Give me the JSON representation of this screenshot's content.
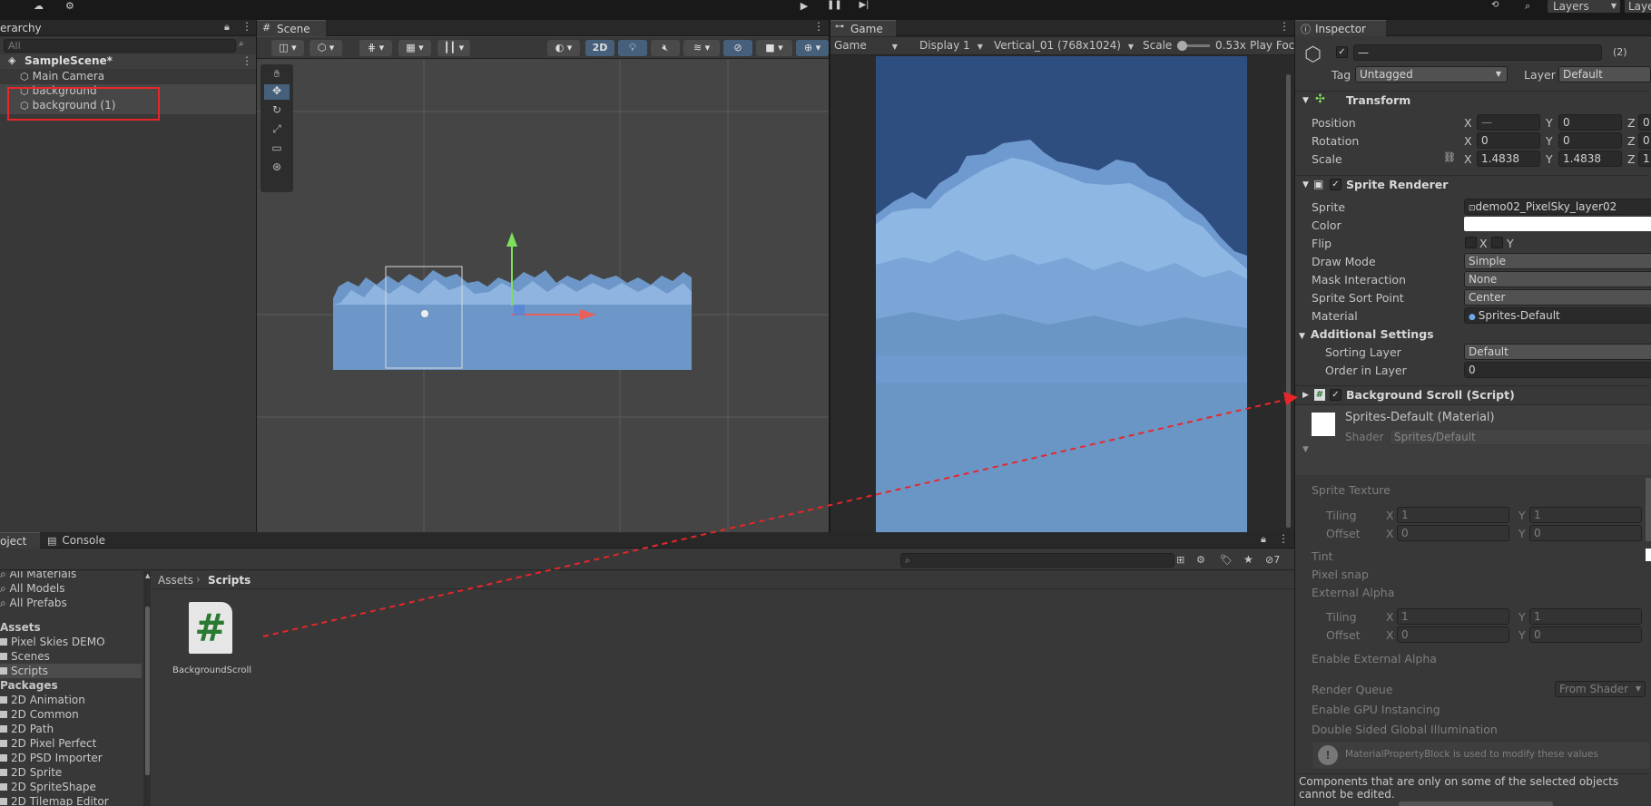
{
  "toolbar": {
    "layers": "Layers",
    "layers2": "Layer"
  },
  "hierarchy": {
    "tab": "erarchy",
    "search": "All",
    "scene": "SampleScene*",
    "items": [
      "Main Camera",
      "background",
      "background (1)"
    ]
  },
  "scene": {
    "tab": "Scene",
    "btn2d": "2D"
  },
  "game": {
    "tab": "Game",
    "display": "Game",
    "display_num": "Display 1",
    "resolution": "Vertical_01 (768x1024)",
    "scale_label": "Scale",
    "scale_value": "0.53x",
    "play": "Play Foc"
  },
  "project": {
    "tab_project": "oject",
    "tab_console": "Console",
    "favorites": [
      "All Materials",
      "All Models",
      "All Prefabs"
    ],
    "assets_header": "Assets",
    "assets": [
      "Pixel Skies DEMO",
      "Scenes",
      "Scripts"
    ],
    "packages_header": "Packages",
    "packages": [
      "2D Animation",
      "2D Common",
      "2D Path",
      "2D Pixel Perfect",
      "2D PSD Importer",
      "2D Sprite",
      "2D SpriteShape",
      "2D Tilemap Editor"
    ],
    "breadcrumb_root": "Assets",
    "breadcrumb_current": "Scripts",
    "file_name": "BackgroundScroll",
    "hidden_count": "7"
  },
  "inspector": {
    "tab": "Inspector",
    "object_name": "—",
    "multi_count": "(2)",
    "tag_label": "Tag",
    "tag_value": "Untagged",
    "layer_label": "Layer",
    "layer_value": "Default",
    "transform": {
      "title": "Transform",
      "position_label": "Position",
      "pos_x": "—",
      "pos_y": "0",
      "pos_z": "0",
      "rotation_label": "Rotation",
      "rot_x": "0",
      "rot_y": "0",
      "rot_z": "0",
      "scale_label": "Scale",
      "scale_x": "1.4838",
      "scale_y": "1.4838",
      "scale_z": "1."
    },
    "sprite_renderer": {
      "title": "Sprite Renderer",
      "sprite_label": "Sprite",
      "sprite_value": "demo02_PixelSky_layer02",
      "color_label": "Color",
      "flip_label": "Flip",
      "flip_x": "X",
      "flip_y": "Y",
      "draw_mode_label": "Draw Mode",
      "draw_mode_value": "Simple",
      "mask_label": "Mask Interaction",
      "mask_value": "None",
      "sort_point_label": "Sprite Sort Point",
      "sort_point_value": "Center",
      "material_label": "Material",
      "material_value": "Sprites-Default",
      "additional": "Additional Settings",
      "sorting_layer_label": "Sorting Layer",
      "sorting_layer_value": "Default",
      "order_label": "Order in Layer",
      "order_value": "0"
    },
    "script": {
      "title": "Background Scroll (Script)"
    },
    "material": {
      "title": "Sprites-Default (Material)",
      "shader_label": "Shader",
      "shader_value": "Sprites/Default",
      "sprite_texture": "Sprite Texture",
      "tiling": "Tiling",
      "offset": "Offset",
      "x": "X",
      "y": "Y",
      "tiling_x": "1",
      "tiling_y": "1",
      "offset_x": "0",
      "offset_y": "0",
      "tint": "Tint",
      "pixel_snap": "Pixel snap",
      "external_alpha": "External Alpha",
      "enable_external_alpha": "Enable External Alpha",
      "render_queue": "Render Queue",
      "render_queue_value": "From Shader",
      "gpu_instancing": "Enable GPU Instancing",
      "double_sided": "Double Sided Global Illumination",
      "info": "MaterialPropertyBlock is used to modify these values"
    },
    "footer": "Components that are only on some of the selected objects cannot be edited."
  },
  "colors": {
    "annotation_red": "#e8262a",
    "selection_blue": "#2c5d87",
    "sky_dark": "#2f4e80",
    "sky_light": "#6a96c6",
    "cloud": "#8fb7e3"
  }
}
